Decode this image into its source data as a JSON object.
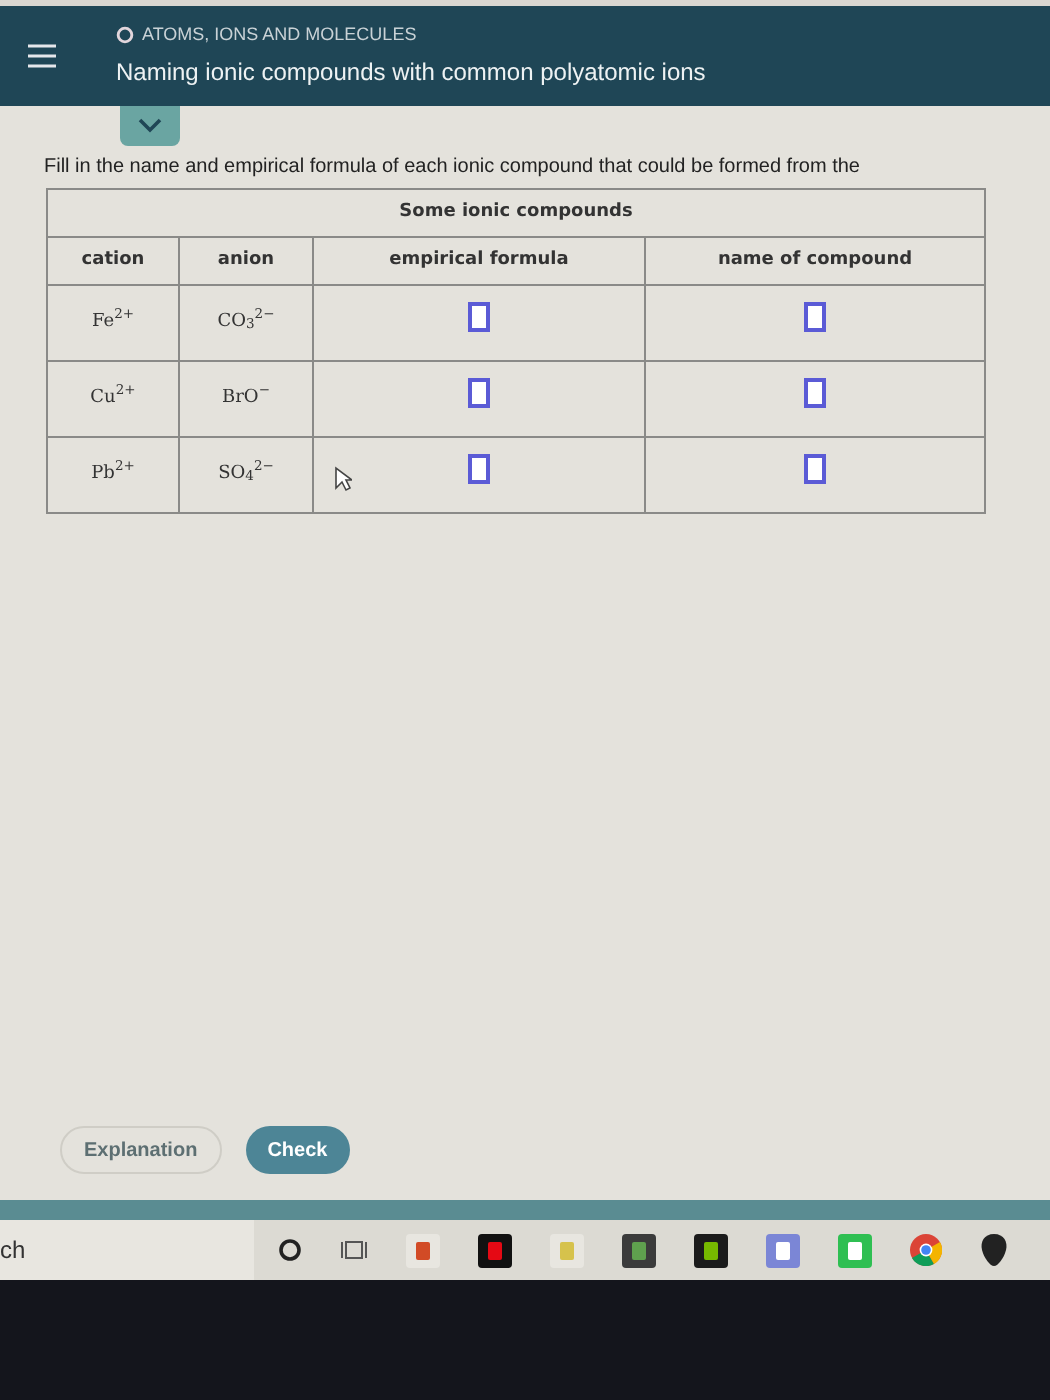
{
  "header": {
    "section": "ATOMS, IONS AND MOLECULES",
    "title": "Naming ionic compounds with common polyatomic ions"
  },
  "instruction": "Fill in the name and empirical formula of each ionic compound that could be formed from the",
  "table": {
    "caption": "Some ionic compounds",
    "columns": [
      "cation",
      "anion",
      "empirical formula",
      "name of compound"
    ],
    "rows": [
      {
        "cation": "Fe$^{2+}$",
        "anion": "CO$_{3}$$^{2−}$"
      },
      {
        "cation": "Cu$^{2+}$",
        "anion": "BrO$^{−}$"
      },
      {
        "cation": "Pb$^{2+}$",
        "anion": "SO$_{4}$$^{2−}$"
      }
    ]
  },
  "buttons": [
    {
      "label": "Explanation",
      "kind": "secondary"
    },
    {
      "label": "Check",
      "kind": "primary"
    }
  ],
  "taskbar": {
    "search": "ch"
  }
}
